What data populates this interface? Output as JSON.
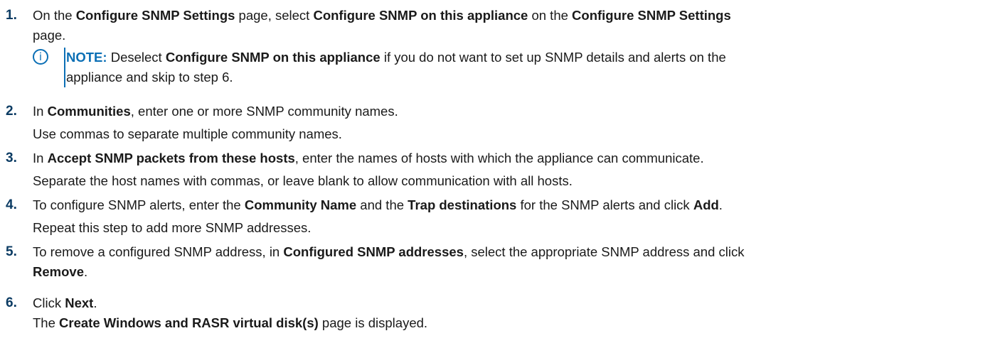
{
  "steps": [
    {
      "number": "1.",
      "lines": [
        [
          "On the ",
          "Configure SNMP Settings",
          " page, select ",
          "Configure SNMP on this appliance",
          " on the ",
          "Configure SNMP Settings"
        ],
        [
          "page."
        ]
      ],
      "note": {
        "label": "NOTE:",
        "line1_a": " Deselect ",
        "line1_b": "Configure SNMP on this appliance",
        "line1_c": " if you do not want to set up SNMP details and alerts on the",
        "line2": "appliance and skip to step 6."
      }
    },
    {
      "number": "2.",
      "p1_a": "In ",
      "p1_b": "Communities",
      "p1_c": ", enter one or more SNMP community names.",
      "p2": "Use commas to separate multiple community names."
    },
    {
      "number": "3.",
      "p1_a": "In ",
      "p1_b": "Accept SNMP packets from these hosts",
      "p1_c": ", enter the names of hosts with which the appliance can communicate.",
      "p2": "Separate the host names with commas, or leave blank to allow communication with all hosts."
    },
    {
      "number": "4.",
      "p1_a": "To configure SNMP alerts, enter the ",
      "p1_b": "Community Name",
      "p1_c": " and the ",
      "p1_d": "Trap destinations",
      "p1_e": " for the SNMP alerts and click ",
      "p1_f": "Add",
      "p1_g": ".",
      "p2": "Repeat this step to add more SNMP addresses."
    },
    {
      "number": "5.",
      "p1_a": "To remove a configured SNMP address, in ",
      "p1_b": "Configured SNMP addresses",
      "p1_c": ", select the appropriate SNMP address and click",
      "p2_a": "Remove",
      "p2_b": "."
    },
    {
      "number": "6.",
      "p1_a": "Click ",
      "p1_b": "Next",
      "p1_c": ".",
      "p2_a": "The ",
      "p2_b": "Create Windows and RASR virtual disk(s)",
      "p2_c": " page is displayed."
    }
  ],
  "colors": {
    "step_number": "#0b3b63",
    "note_accent": "#0b6fb5",
    "text": "#1a1a1a"
  },
  "icons": {
    "note": "info-circle-icon"
  }
}
